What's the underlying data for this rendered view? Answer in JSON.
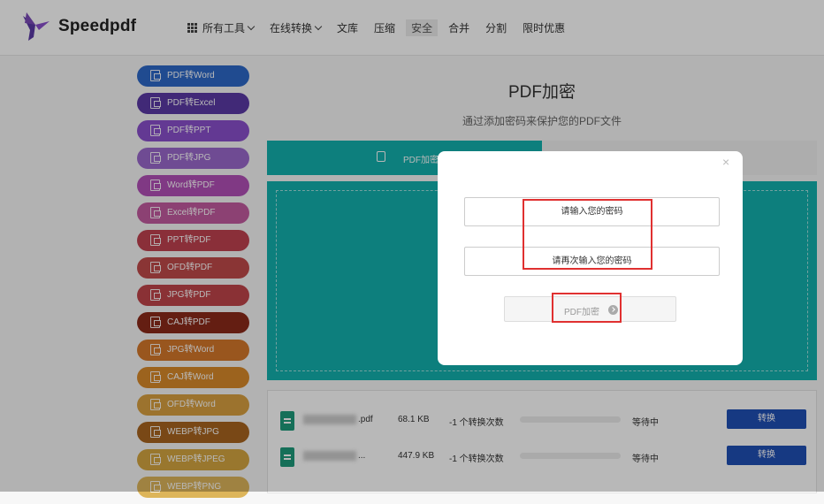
{
  "header": {
    "brand": "Speedpdf",
    "nav": [
      {
        "label": "所有工具",
        "has_dropdown": true,
        "icon": "grid-icon"
      },
      {
        "label": "在线转换",
        "has_dropdown": true
      },
      {
        "label": "文库"
      },
      {
        "label": "压缩"
      },
      {
        "label": "安全",
        "active": true
      },
      {
        "label": "合并"
      },
      {
        "label": "分割"
      },
      {
        "label": "限时优惠"
      }
    ]
  },
  "sidebar": {
    "items": [
      {
        "label": "PDF转Word",
        "color": "#2d68c8"
      },
      {
        "label": "PDF转Excel",
        "color": "#5a3aa5"
      },
      {
        "label": "PDF转PPT",
        "color": "#8a4fcc"
      },
      {
        "label": "PDF转JPG",
        "color": "#9a68cc"
      },
      {
        "label": "Word转PDF",
        "color": "#b24fb8"
      },
      {
        "label": "Excel转PDF",
        "color": "#c25ba0"
      },
      {
        "label": "PPT转PDF",
        "color": "#bf4250"
      },
      {
        "label": "OFD转PDF",
        "color": "#c04a4a"
      },
      {
        "label": "JPG转PDF",
        "color": "#c0454a"
      },
      {
        "label": "CAJ转PDF",
        "color": "#8b2a1a"
      },
      {
        "label": "JPG转Word",
        "color": "#d4782a"
      },
      {
        "label": "CAJ转Word",
        "color": "#d8892a"
      },
      {
        "label": "OFD转Word",
        "color": "#d8a040"
      },
      {
        "label": "WEBP转JPG",
        "color": "#a8651f"
      },
      {
        "label": "WEBP转JPEG",
        "color": "#d4a640"
      },
      {
        "label": "WEBP转PNG",
        "color": "#ddb55a"
      }
    ]
  },
  "main": {
    "title": "PDF加密",
    "subtitle": "通过添加密码来保护您的PDF文件",
    "tab_label": "PDF加密"
  },
  "files": [
    {
      "name": ".pdf",
      "size": "68.1 KB",
      "count": "-1 个转换次数",
      "progress": 0.1,
      "status": "等待中",
      "button": "转换"
    },
    {
      "name": "...",
      "size": "447.9 KB",
      "count": "-1 个转换次数",
      "progress": 0,
      "status": "等待中",
      "button": "转换"
    }
  ],
  "modal": {
    "close": "×",
    "password_placeholder": "请输入您的密码",
    "confirm_placeholder": "请再次输入您的密码",
    "submit_label": "PDF加密"
  },
  "colors": {
    "accent": "#13b1ad",
    "convert_button": "#1f4fb5",
    "highlight": "#e03030"
  }
}
